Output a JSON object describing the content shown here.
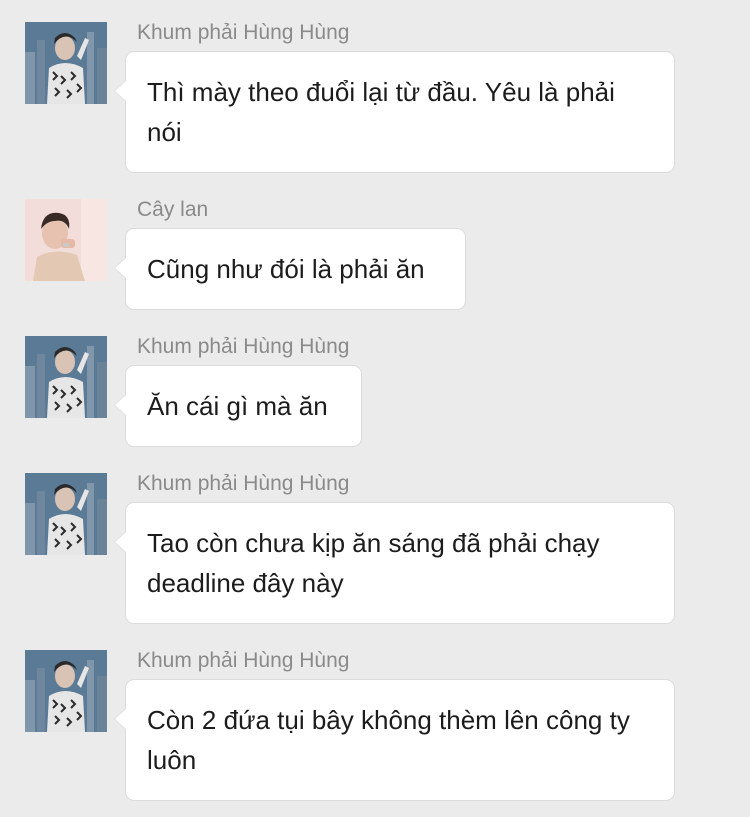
{
  "messages": [
    {
      "sender": "Khum phải Hùng Hùng",
      "avatar": "avatar-city-man",
      "text": "Thì mày theo đuổi lại từ đầu. Yêu là phải nói"
    },
    {
      "sender": "Cây lan",
      "avatar": "avatar-pink-man",
      "text": "Cũng như đói là phải ăn"
    },
    {
      "sender": "Khum phải Hùng Hùng",
      "avatar": "avatar-city-man",
      "text": "Ăn cái gì mà ăn"
    },
    {
      "sender": "Khum phải Hùng Hùng",
      "avatar": "avatar-city-man",
      "text": "Tao còn chưa kịp ăn sáng đã phải chạy deadline đây này"
    },
    {
      "sender": "Khum phải Hùng Hùng",
      "avatar": "avatar-city-man",
      "text": "Còn 2 đứa tụi bây không thèm lên công ty luôn"
    }
  ]
}
